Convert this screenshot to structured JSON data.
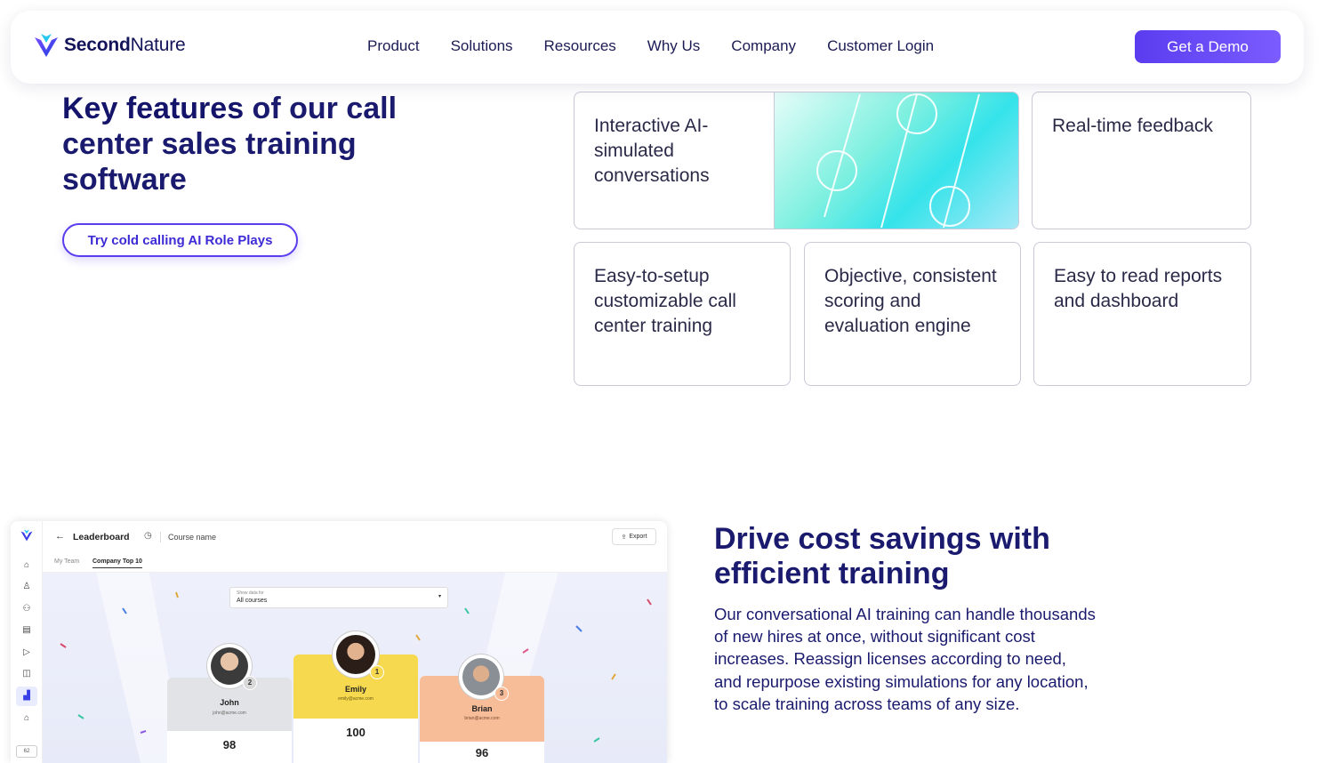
{
  "nav": {
    "brand_bold": "Second",
    "brand_rest": "Nature",
    "links": [
      "Product",
      "Solutions",
      "Resources",
      "Why Us",
      "Company",
      "Customer Login"
    ],
    "cta": "Get a Demo"
  },
  "features": {
    "heading_bold": "Key features",
    "heading_rest": " of our call center sales training software",
    "try_button": "Try cold calling AI Role Plays",
    "cards": [
      "Interactive AI-simulated conversations",
      "Real-time feedback",
      "Easy-to-setup customizable call center training",
      "Objective, consistent scoring and evaluation engine",
      "Easy to read reports and dashboard"
    ]
  },
  "app": {
    "title": "Leaderboard",
    "course": "Course name",
    "export": "Export",
    "tabs": [
      "My Team",
      "Company Top 10"
    ],
    "filter_label": "Show data for",
    "filter_value": "All courses",
    "badge": "62",
    "podium": [
      {
        "name": "John",
        "email": "john@acme.com",
        "rank": "2",
        "score": "98"
      },
      {
        "name": "Emily",
        "email": "emily@acme.com",
        "rank": "1",
        "score": "100"
      },
      {
        "name": "Brian",
        "email": "brian@acme.com",
        "rank": "3",
        "score": "96"
      }
    ]
  },
  "cost": {
    "title": "Drive cost savings with efficient training",
    "body": "Our conversational AI training can handle thousands of new hires at once, without significant cost increases. Reassign licenses according to need, and repurpose existing simulations for any location, to scale training across teams of any size."
  },
  "colors": {
    "accent": "#5b3df0",
    "text": "#1a1a6e",
    "gold": "#f6d94f",
    "peach": "#f7bc98"
  }
}
